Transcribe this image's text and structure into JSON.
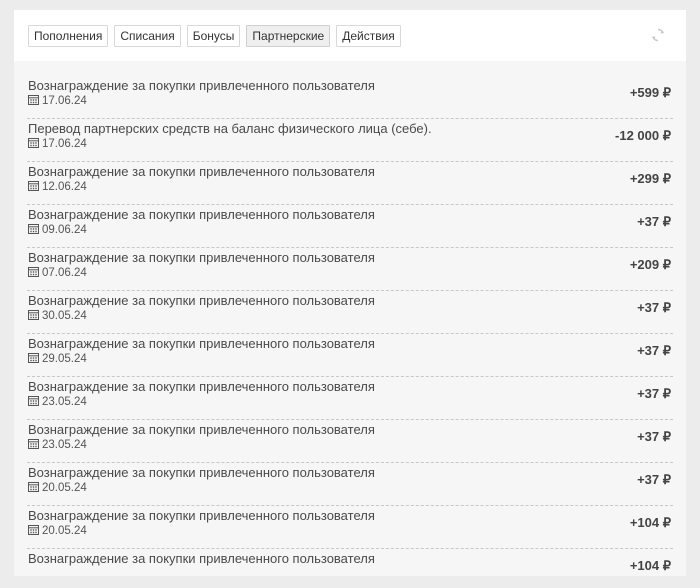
{
  "tabs": [
    {
      "label": "Пополнения",
      "active": false
    },
    {
      "label": "Списания",
      "active": false
    },
    {
      "label": "Бонусы",
      "active": false
    },
    {
      "label": "Партнерские",
      "active": true
    },
    {
      "label": "Действия",
      "active": false
    }
  ],
  "icons": {
    "refresh": "refresh-icon",
    "calendar": "calendar-icon"
  },
  "transactions": [
    {
      "title": "Вознаграждение за покупки привлеченного пользователя",
      "date": "17.06.24",
      "amount": "+599 ₽"
    },
    {
      "title": "Перевод партнерских средств на баланс физического лица (себе).",
      "date": "17.06.24",
      "amount": "-12 000 ₽"
    },
    {
      "title": "Вознаграждение за покупки привлеченного пользователя",
      "date": "12.06.24",
      "amount": "+299 ₽"
    },
    {
      "title": "Вознаграждение за покупки привлеченного пользователя",
      "date": "09.06.24",
      "amount": "+37 ₽"
    },
    {
      "title": "Вознаграждение за покупки привлеченного пользователя",
      "date": "07.06.24",
      "amount": "+209 ₽"
    },
    {
      "title": "Вознаграждение за покупки привлеченного пользователя",
      "date": "30.05.24",
      "amount": "+37 ₽"
    },
    {
      "title": "Вознаграждение за покупки привлеченного пользователя",
      "date": "29.05.24",
      "amount": "+37 ₽"
    },
    {
      "title": "Вознаграждение за покупки привлеченного пользователя",
      "date": "23.05.24",
      "amount": "+37 ₽"
    },
    {
      "title": "Вознаграждение за покупки привлеченного пользователя",
      "date": "23.05.24",
      "amount": "+37 ₽"
    },
    {
      "title": "Вознаграждение за покупки привлеченного пользователя",
      "date": "20.05.24",
      "amount": "+37 ₽"
    },
    {
      "title": "Вознаграждение за покупки привлеченного пользователя",
      "date": "20.05.24",
      "amount": "+104 ₽"
    },
    {
      "title": "Вознаграждение за покупки привлеченного пользователя",
      "date": "",
      "amount": "+104 ₽"
    }
  ]
}
